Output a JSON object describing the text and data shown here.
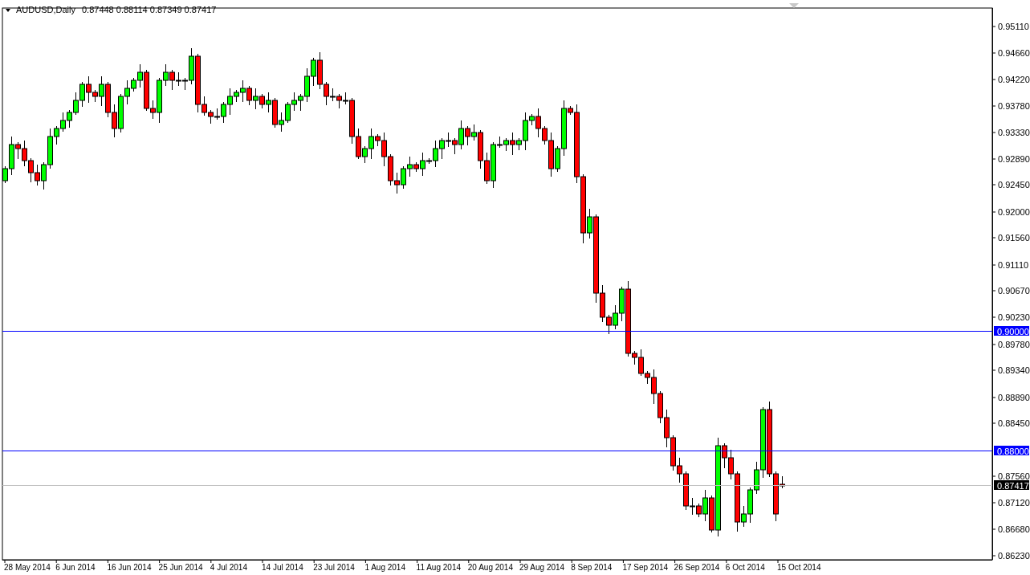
{
  "header": {
    "symbol": "AUDUSD,Daily",
    "quotes": [
      "0.87448",
      "0.88114",
      "0.87349",
      "0.87417"
    ]
  },
  "price_axis": {
    "labels": [
      "0.95110",
      "0.94660",
      "0.94220",
      "0.93780",
      "0.93330",
      "0.92890",
      "0.92450",
      "0.92000",
      "0.91560",
      "0.91110",
      "0.90670",
      "0.90230",
      "0.89780",
      "0.89340",
      "0.88890",
      "0.88450",
      "0.87560",
      "0.87120",
      "0.86680",
      "0.86230"
    ]
  },
  "time_axis": {
    "labels": [
      "28 May 2014",
      "6 Jun 2014",
      "16 Jun 2014",
      "25 Jun 2014",
      "4 Jul 2014",
      "14 Jul 2014",
      "23 Jul 2014",
      "1 Aug 2014",
      "11 Aug 2014",
      "20 Aug 2014",
      "29 Aug 2014",
      "8 Sep 2014",
      "17 Sep 2014",
      "26 Sep 2014",
      "6 Oct 2014",
      "15 Oct 2014"
    ]
  },
  "levels": [
    {
      "kind": "line",
      "label": "0.90000",
      "color": "#0000ff"
    },
    {
      "kind": "line",
      "label": "0.88000",
      "color": "#0000ff"
    },
    {
      "kind": "bid",
      "label": "0.87417",
      "color": "#000000"
    }
  ]
}
